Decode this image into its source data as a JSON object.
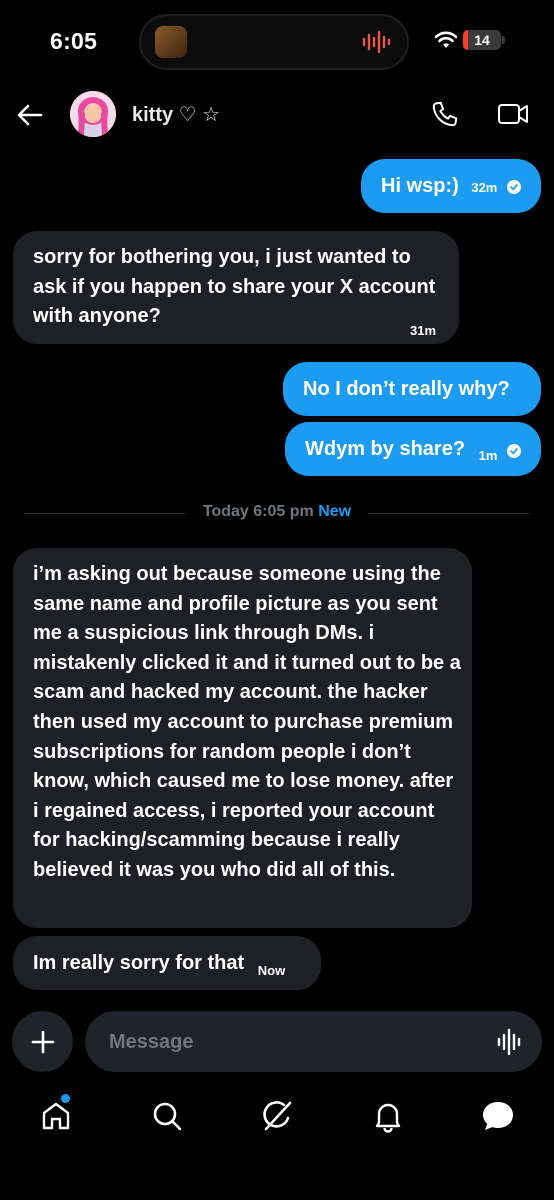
{
  "status_bar": {
    "time": "6:05",
    "battery": "14",
    "battery_level": 0.14,
    "battery_color": "#ff3b30"
  },
  "header": {
    "contact_name": "kitty ♡ ☆"
  },
  "colors": {
    "accent": "#1d9bf0",
    "incoming_bubble": "#1e2023",
    "background": "#000000",
    "muted": "#71767b"
  },
  "messages": [
    {
      "id": "m1",
      "direction": "outgoing",
      "text": "Hi wsp:)",
      "time": "32m",
      "read": true
    },
    {
      "id": "m2",
      "direction": "incoming",
      "text": "sorry for bothering you, i just wanted to ask if you happen to share your X account with anyone?",
      "time": "31m"
    },
    {
      "id": "m3",
      "direction": "outgoing",
      "text": "No I don’t really why?"
    },
    {
      "id": "m4",
      "direction": "outgoing",
      "text": "Wdym by share?",
      "time": "1m",
      "read": true
    },
    {
      "id": "m5",
      "direction": "incoming",
      "text": "i’m asking out because someone using the same name and profile picture as you sent me a suspicious link through DMs. i mistakenly clicked it and it turned out to be a scam and hacked my account. the hacker then used my account to purchase premium subscriptions for random people i don’t know, which caused me to lose money. after i regained access, i reported your account for hacking/scamming because i really believed it was you who did all of this."
    },
    {
      "id": "m6",
      "direction": "incoming",
      "text": "Im really sorry for that",
      "time": "Now"
    }
  ],
  "divider": {
    "label": "Today 6:05 pm",
    "badge": "New"
  },
  "composer": {
    "placeholder": "Message"
  },
  "nav": [
    {
      "name": "home-icon",
      "has_badge": true
    },
    {
      "name": "search-icon"
    },
    {
      "name": "grok-icon"
    },
    {
      "name": "notifications-icon"
    },
    {
      "name": "messages-icon",
      "active": true
    }
  ]
}
